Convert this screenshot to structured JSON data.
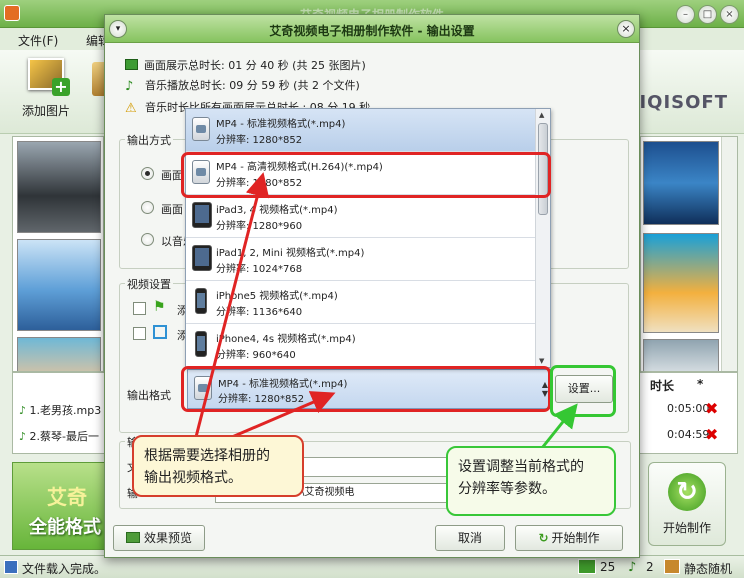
{
  "app": {
    "title": "艾奇视频电子相册制作软件",
    "menu": [
      "文件(F)",
      "编辑"
    ],
    "toolbar": {
      "add_photo": "添加图片"
    },
    "logo_text": "AIQISOFT",
    "audio_columns": {
      "duration": "时长",
      "star": "*"
    },
    "audio_rows": [
      {
        "name": "1.老男孩.mp3",
        "time": "0:05:00"
      },
      {
        "name": "2.蔡琴-最后一",
        "time": "0:04:59"
      }
    ],
    "banner": {
      "line1": "艾奇",
      "line2": "全能格式"
    },
    "start_button": "开始制作",
    "status": {
      "text": "文件载入完成。",
      "photos": "25",
      "music": "2",
      "mode": "静态随机"
    }
  },
  "dialog": {
    "title": "艾奇视频电子相册制作软件 - 输出设置",
    "info": [
      "画面展示总时长: 01 分 40 秒 (共 25 张图片)",
      "音乐播放总时长: 09 分 59 秒 (共 2 个文件)",
      "音乐时长比所有画面展示总时长 : 08 分 19 秒"
    ],
    "output_mode": {
      "label": "输出方式",
      "options": [
        "画面",
        "画面",
        "以音乐"
      ]
    },
    "video_settings": {
      "label": "视频设置",
      "options": [
        "添",
        "添"
      ]
    },
    "format_label": "输出格式",
    "selected_format": {
      "name": "MP4 - 标准视频格式(*.mp4)",
      "res": "分辨率: 1280*852"
    },
    "settings_button": "设置...",
    "output": {
      "label": "输",
      "name_label": "文",
      "path_label": "输",
      "path_value": "uments\\艾奇软件\\艾奇视频电"
    },
    "buttons": {
      "preview": "效果预览",
      "cancel": "取消",
      "start": "开始制作"
    },
    "format_list": [
      {
        "name": "MP4 - 标准视频格式(*.mp4)",
        "res": "分辨率: 1280*852",
        "icon": "mp4-icon"
      },
      {
        "name": "MP4 - 高清视频格式(H.264)(*.mp4)",
        "res": "分辨率: 1280*852",
        "icon": "mp4-icon"
      },
      {
        "name": "iPad3, 4 视频格式(*.mp4)",
        "res": "分辨率: 1280*960",
        "icon": "ipad-icon"
      },
      {
        "name": "iPad1, 2, Mini 视频格式(*.mp4)",
        "res": "分辨率: 1024*768",
        "icon": "ipad-icon"
      },
      {
        "name": "iPhone5 视频格式(*.mp4)",
        "res": "分辨率: 1136*640",
        "icon": "iphone-icon"
      },
      {
        "name": "iPhone4, 4s 视频格式(*.mp4)",
        "res": "分辨率: 960*640",
        "icon": "iphone-icon"
      }
    ]
  },
  "annotations": {
    "red_callout": [
      "根据需要选择相册的",
      "输出视频格式。"
    ],
    "green_callout": [
      "设置调整当前格式的",
      "分辨率等参数。"
    ],
    "colors": {
      "red": "#e02424",
      "green": "#35c733"
    }
  }
}
